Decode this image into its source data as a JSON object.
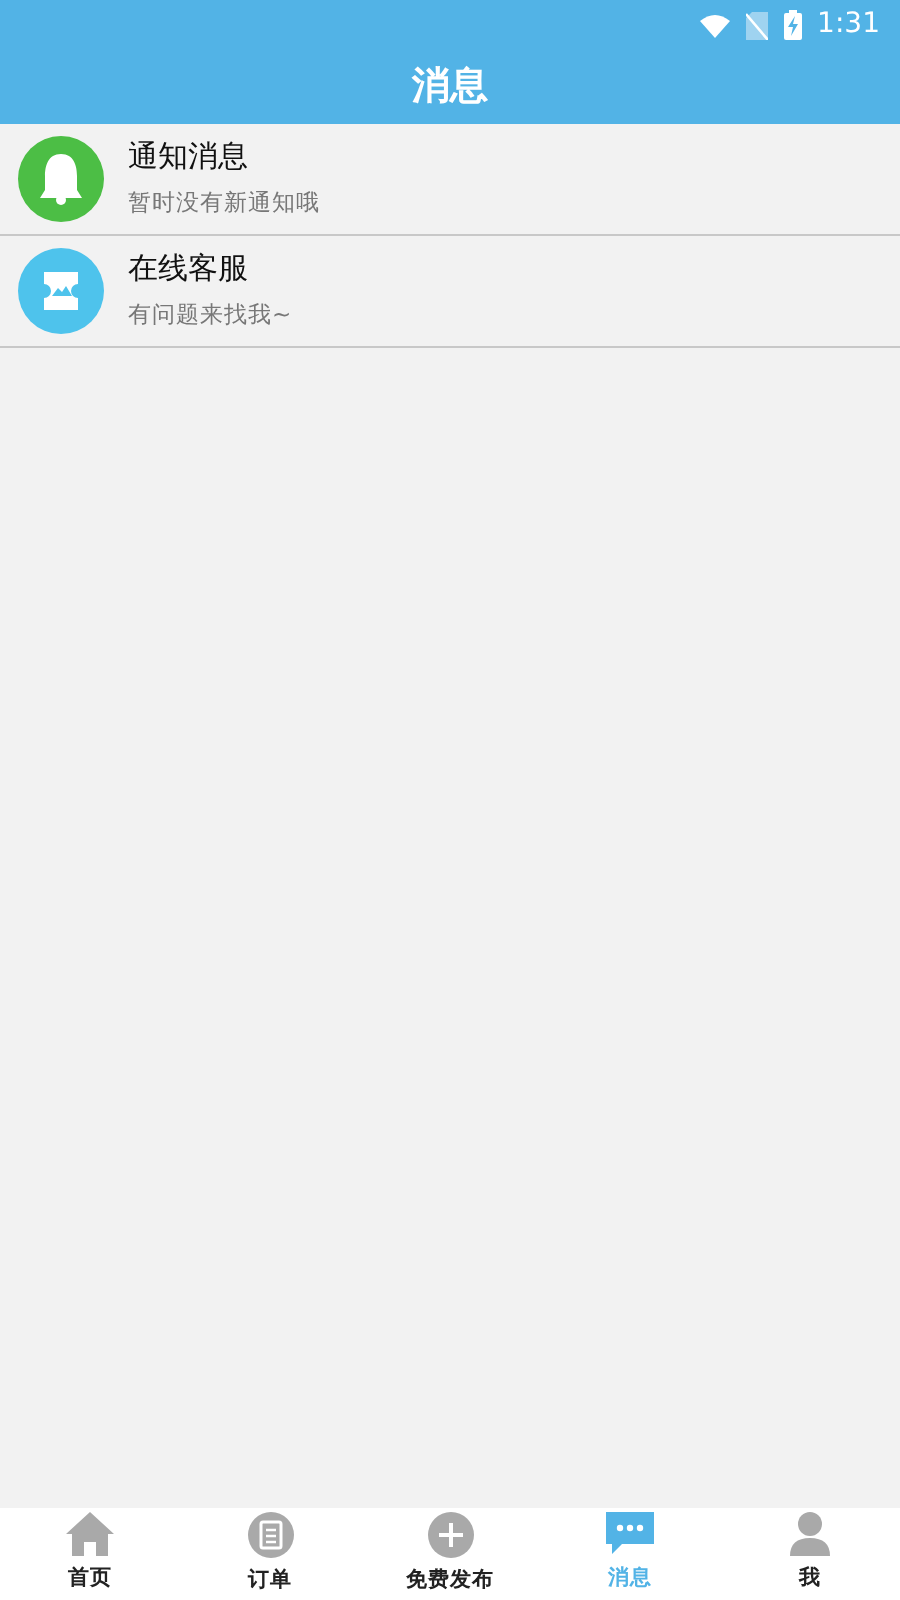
{
  "status_bar": {
    "time": "1:31"
  },
  "header": {
    "title": "消息"
  },
  "messages": [
    {
      "color": "#4cbe45",
      "title": "通知消息",
      "subtitle": "暂时没有新通知哦"
    },
    {
      "color": "#4ec3ec",
      "title": "在线客服",
      "subtitle": "有问题来找我~"
    }
  ],
  "tabs": [
    {
      "label": "首页",
      "selected": false
    },
    {
      "label": "订单",
      "selected": false
    },
    {
      "label": "免费发布",
      "selected": false
    },
    {
      "label": "消息",
      "selected": true
    },
    {
      "label": "我",
      "selected": false
    }
  ]
}
